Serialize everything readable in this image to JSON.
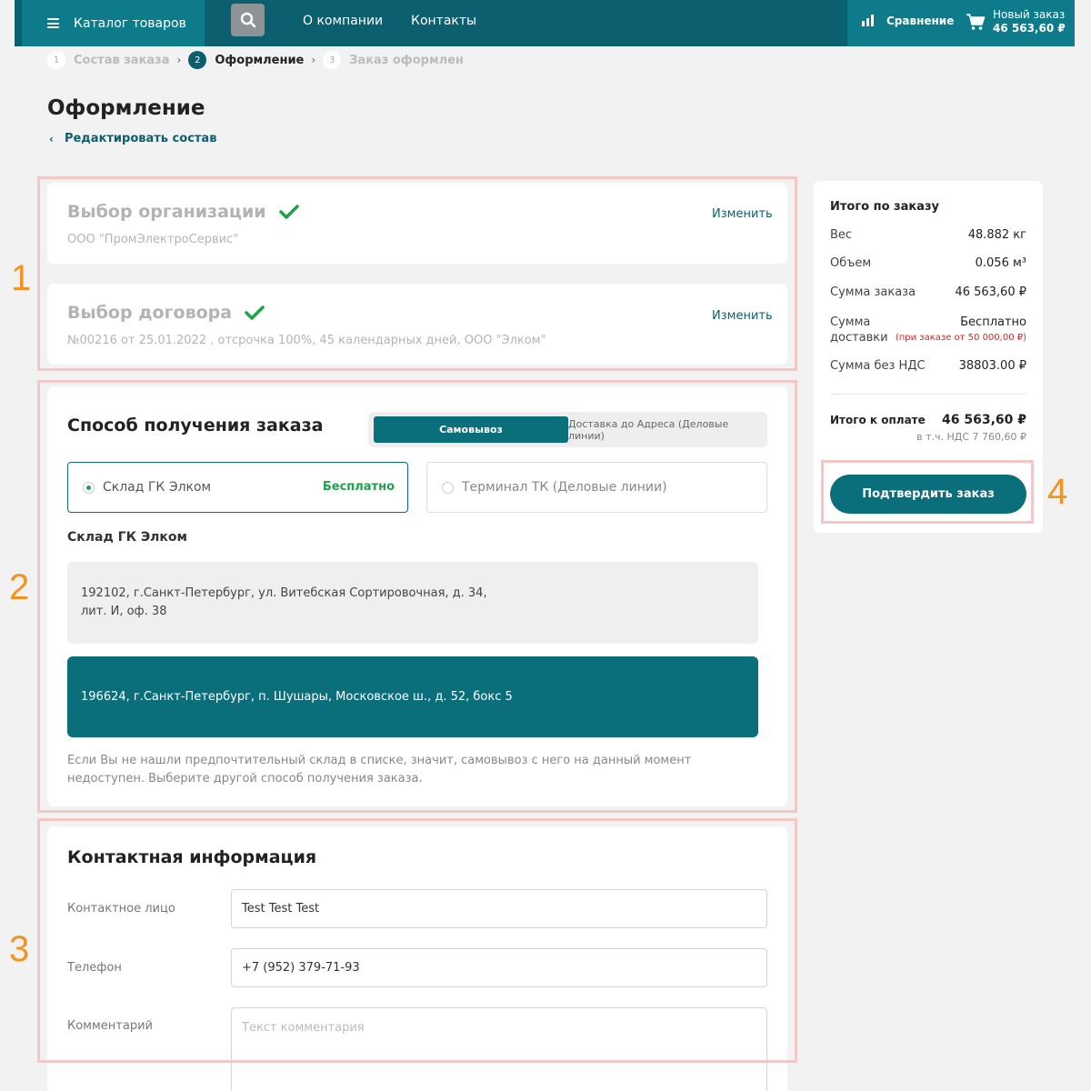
{
  "header": {
    "catalog_label": "Каталог товаров",
    "nav": [
      "О компании",
      "Контакты"
    ],
    "compare_label": "Сравнение",
    "cart_title": "Новый заказ",
    "cart_total": "46 563,60 ₽"
  },
  "steps": [
    {
      "num": "1",
      "label": "Состав заказа"
    },
    {
      "num": "2",
      "label": "Оформление"
    },
    {
      "num": "3",
      "label": "Заказ оформлен"
    }
  ],
  "page": {
    "title": "Оформление",
    "back_link": "Редактировать состав"
  },
  "annotations": [
    "1",
    "2",
    "3",
    "4"
  ],
  "organization": {
    "title": "Выбор организации",
    "value": "ООО \"ПромЭлектроСервис\"",
    "change": "Изменить"
  },
  "contract": {
    "title": "Выбор договора",
    "value": "№00216 от 25.01.2022 , отсрочка 100%, 45 календарных дней, ООО \"Элком\"",
    "change": "Изменить"
  },
  "delivery": {
    "title": "Способ получения заказа",
    "tabs": [
      "Самовывоз",
      "Доставка до Адреса (Деловые линии)"
    ],
    "options": [
      {
        "label": "Склад ГК Элком",
        "tag": "Бесплатно",
        "selected": true
      },
      {
        "label": "Терминал ТК (Деловые линии)",
        "selected": false
      }
    ],
    "warehouse_title": "Склад ГК Элком",
    "addresses": [
      "192102, г.Санкт-Петербург, ул. Витебская Сортировочная, д. 34, лит. И, оф. 38",
      "196624, г.Санкт-Петербург, п. Шушары, Московское ш., д. 52, бокс 5"
    ],
    "hint": "Если Вы не нашли предпочтительный склад в списке, значит, самовывоз с него на данный момент недоступен. Выберите другой способ получения заказа."
  },
  "contacts": {
    "title": "Контактная информация",
    "fields": [
      {
        "label": "Контактное лицо",
        "value": "Test Test Test"
      },
      {
        "label": "Телефон",
        "value": "+7 (952) 379-71-93"
      },
      {
        "label": "Комментарий",
        "placeholder": "Текст комментария"
      }
    ]
  },
  "summary": {
    "title": "Итого по заказу",
    "rows": [
      {
        "label": "Вес",
        "value": "48.882 кг"
      },
      {
        "label": "Объем",
        "value": "0.056 м³"
      },
      {
        "label": "Сумма заказа",
        "value": "46 563,60 ₽"
      },
      {
        "label": "Сумма доставки",
        "value": "Бесплатно",
        "note": "(при заказе от 50 000,00 ₽)"
      },
      {
        "label": "Сумма без НДС",
        "value": "38803.00 ₽"
      }
    ],
    "total_label": "Итого к оплате",
    "total_value": "46 563,60 ₽",
    "vat_note": "в т.ч. НДС 7 760,60 ₽",
    "confirm": "Подтвердить заказ"
  },
  "colors": {
    "header": "#0b5f6f",
    "accent": "#0b6f7b",
    "success": "#1ea34c",
    "annotation": "#f39322",
    "annotation_frame": "#f5c6c6"
  }
}
